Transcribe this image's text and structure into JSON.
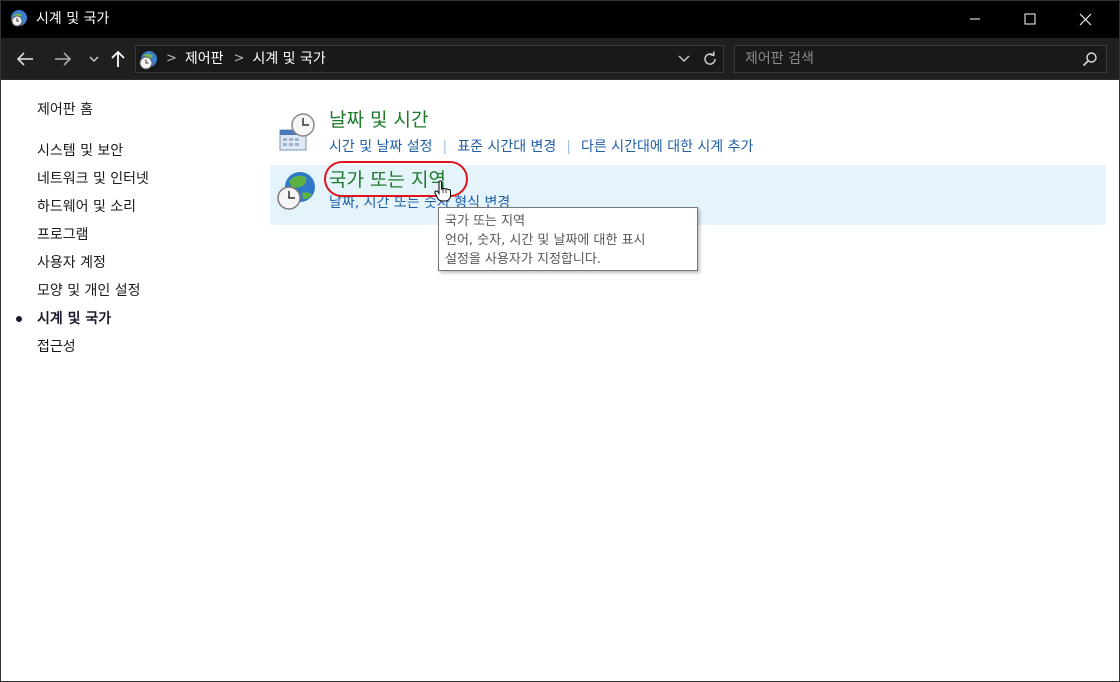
{
  "window": {
    "title": "시계 및 국가",
    "minimize_icon": "minimize-icon",
    "maximize_icon": "maximize-icon",
    "close_icon": "close-icon"
  },
  "navigation": {
    "back_icon": "arrow-left-icon",
    "forward_icon": "arrow-right-icon",
    "recent_icon": "chevron-down-icon",
    "up_icon": "arrow-up-icon",
    "breadcrumbs": [
      "제어판",
      "시계 및 국가"
    ],
    "refresh_icon": "refresh-icon"
  },
  "search": {
    "placeholder": "제어판 검색",
    "icon": "search-icon"
  },
  "sidebar": {
    "items": [
      {
        "label": "제어판 홈",
        "active": false
      },
      {
        "label": "시스템 및 보안",
        "active": false
      },
      {
        "label": "네트워크 및 인터넷",
        "active": false
      },
      {
        "label": "하드웨어 및 소리",
        "active": false
      },
      {
        "label": "프로그램",
        "active": false
      },
      {
        "label": "사용자 계정",
        "active": false
      },
      {
        "label": "모양 및 개인 설정",
        "active": false
      },
      {
        "label": "시계 및 국가",
        "active": true
      },
      {
        "label": "접근성",
        "active": false
      }
    ]
  },
  "categories": [
    {
      "title": "날짜 및 시간",
      "icon": "clock-calendar-icon",
      "links": [
        "시간 및 날짜 설정",
        "표준 시간대 변경",
        "다른 시간대에 대한 시계 추가"
      ]
    },
    {
      "title": "국가 또는 지역",
      "icon": "globe-clock-icon",
      "links": [
        "날짜, 시간 또는 숫자 형식 변경"
      ]
    }
  ],
  "tooltip": {
    "title": "국가 또는 지역",
    "line1": "언어, 숫자, 시간 및 날짜에 대한 표시",
    "line2": "설정을 사용자가 지정합니다."
  },
  "colors": {
    "category_title": "#1e7a2b",
    "link": "#1f5fa8",
    "highlight": "#e0141e",
    "hover_background": "#e5f3fb"
  }
}
